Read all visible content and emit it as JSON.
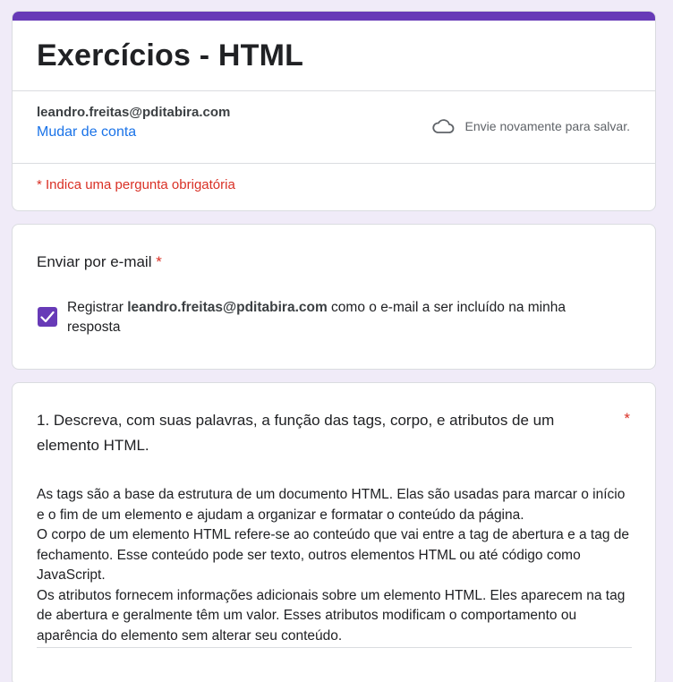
{
  "header": {
    "title": "Exercícios - HTML",
    "account_email": "leandro.freitas@pditabira.com",
    "switch_account": "Mudar de conta",
    "save_status": "Envie novamente para salvar.",
    "save_icon": "cloud-icon",
    "required_note": "* Indica uma pergunta obrigatória"
  },
  "email_question": {
    "title": "Enviar por e-mail",
    "required_mark": "*",
    "checkbox_checked": true,
    "label_prefix": "Registrar ",
    "label_email": "leandro.freitas@pditabira.com",
    "label_suffix": " como o e-mail a ser incluído na minha resposta"
  },
  "question_1": {
    "title": "1. Descreva, com suas palavras, a função das tags, corpo, e atributos de um elemento HTML.",
    "required_mark": "*",
    "answer_paragraphs": [
      "As tags são a base da estrutura de um documento HTML. Elas são usadas para marcar o início e o fim de um elemento e ajudam a organizar e formatar o conteúdo da página.",
      "O corpo de um elemento HTML refere-se ao conteúdo que vai entre a tag de abertura e a tag de fechamento. Esse conteúdo pode ser texto, outros elementos HTML ou até código como JavaScript.",
      "Os atributos fornecem informações adicionais sobre um elemento HTML. Eles aparecem na tag de abertura e geralmente têm um valor. Esses atributos modificam o comportamento ou aparência do elemento sem alterar seu conteúdo."
    ]
  },
  "colors": {
    "accent": "#673ab7",
    "background": "#f0ebf8",
    "required": "#d93025",
    "link": "#1a73e8"
  }
}
